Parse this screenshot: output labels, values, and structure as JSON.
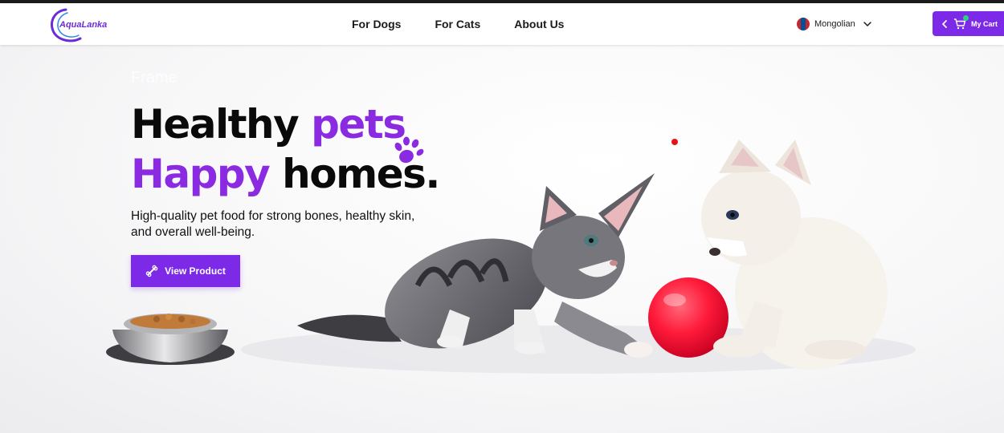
{
  "brand": {
    "logo_text": "AquaLanka"
  },
  "nav": {
    "items": [
      {
        "label": "For Dogs"
      },
      {
        "label": "For Cats"
      },
      {
        "label": "About Us"
      }
    ]
  },
  "language": {
    "selected": "Mongolian",
    "flag_colors": [
      "#c4272f",
      "#015197",
      "#c4272f"
    ]
  },
  "cart": {
    "label": "My Cart"
  },
  "hero": {
    "frame_label": "Frame",
    "headline_line1_a": "Healthy ",
    "headline_line1_b": "pets",
    "headline_line2_a": "Happy",
    "headline_line2_b": " homes.",
    "subtitle": "High-quality pet food for strong bones, healthy skin, and overall well-being.",
    "cta_label": "View Product"
  },
  "colors": {
    "accent": "#7d2ae8",
    "headline_accent": "#8a2be2",
    "text": "#0a0a0a",
    "ball": "#ff1a3a"
  },
  "icons": [
    "chevron-down-icon",
    "chevron-left-icon",
    "cart-icon",
    "bone-icon",
    "paw-icon"
  ]
}
